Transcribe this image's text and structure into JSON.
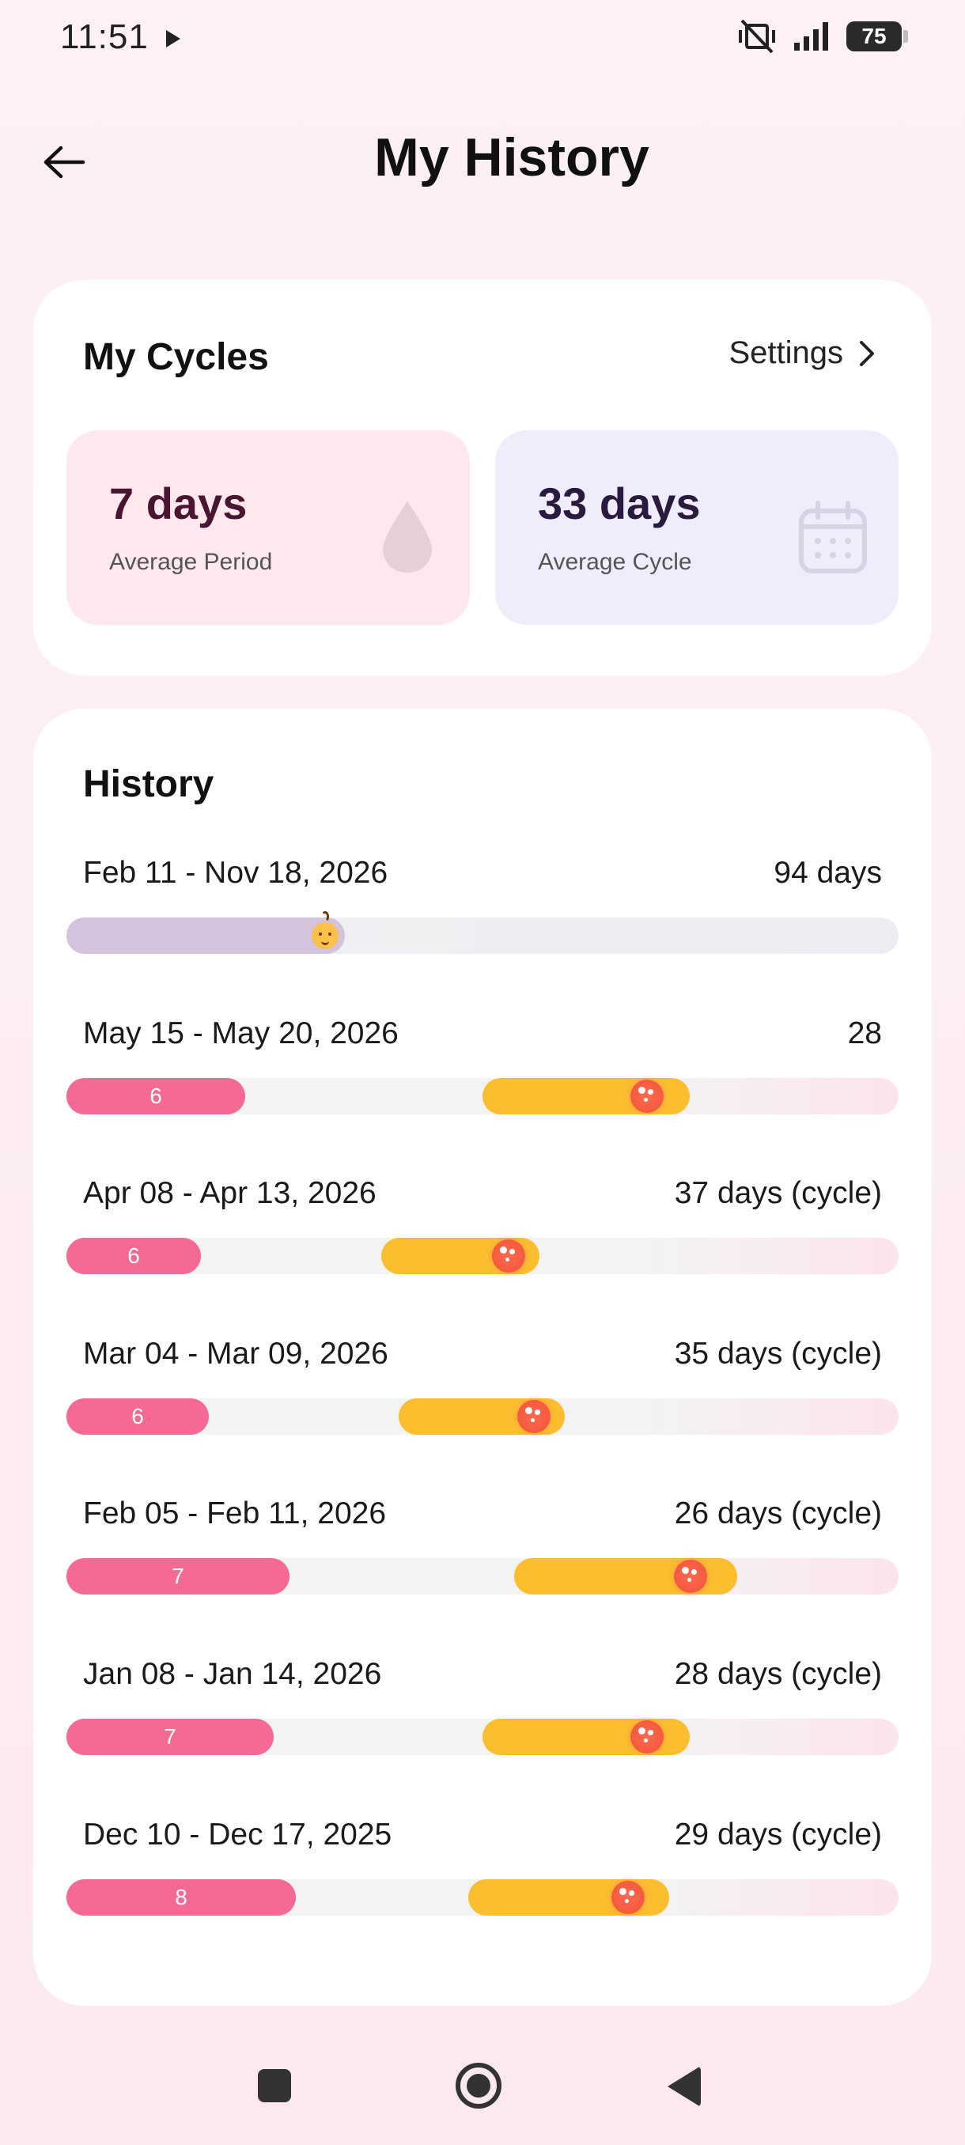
{
  "status_bar": {
    "time": "11:51",
    "battery": "75"
  },
  "header": {
    "title": "My History"
  },
  "cycles_card": {
    "title": "My Cycles",
    "settings_label": "Settings",
    "average_period": {
      "value": "7 days",
      "label": "Average Period",
      "icon": "drop-icon"
    },
    "average_cycle": {
      "value": "33 days",
      "label": "Average Cycle",
      "icon": "calendar-icon"
    }
  },
  "history": {
    "title": "History",
    "pregnancy_row": {
      "dates": "Feb 11 - Nov 18, 2026",
      "length": "94 days",
      "icon": "baby-icon"
    },
    "rows": [
      {
        "dates": "May 15 - May 20, 2026",
        "length": "28",
        "period_days": "6"
      },
      {
        "dates": "Apr 08 - Apr 13, 2026",
        "length": "37 days (cycle)",
        "period_days": "6"
      },
      {
        "dates": "Mar 04 - Mar 09, 2026",
        "length": "35 days (cycle)",
        "period_days": "6"
      },
      {
        "dates": "Feb 05 - Feb 11, 2026",
        "length": "26 days (cycle)",
        "period_days": "7"
      },
      {
        "dates": "Jan 08 - Jan 14, 2026",
        "length": "28 days (cycle)",
        "period_days": "7"
      },
      {
        "dates": "Dec 10 - Dec 17, 2025",
        "length": "29 days (cycle)",
        "period_days": "8"
      }
    ]
  },
  "colors": {
    "period": "#f46a94",
    "ovulation": "#fbbe2e",
    "pregnancy": "#d3c3dc",
    "avg_period_bg": "#fde8ee",
    "avg_cycle_bg": "#efedfc"
  }
}
